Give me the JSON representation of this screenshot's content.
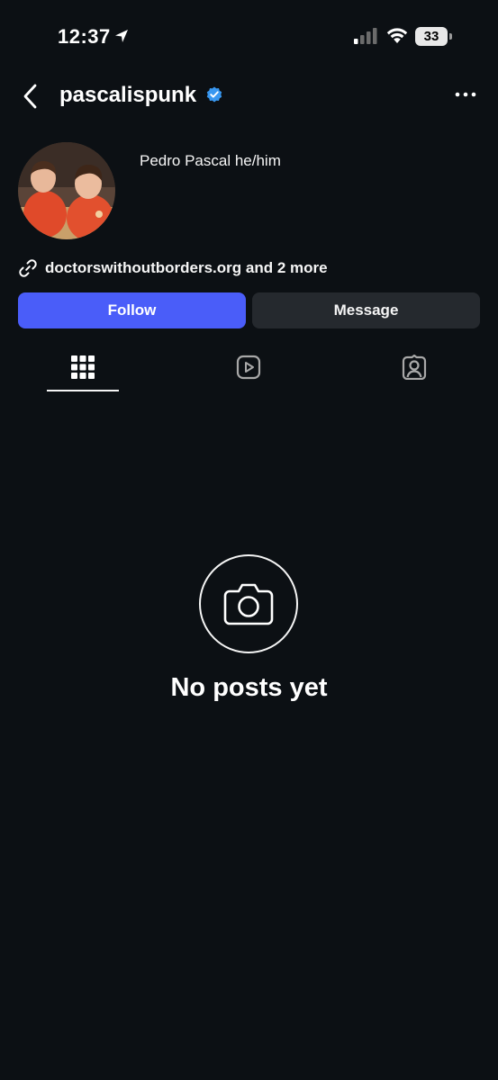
{
  "status_bar": {
    "time": "12:37",
    "battery": "33"
  },
  "header": {
    "username": "pascalispunk"
  },
  "profile": {
    "display_name": "Pedro Pascal he/him",
    "link": "doctorswithoutborders.org and 2 more"
  },
  "actions": {
    "follow": "Follow",
    "message": "Message"
  },
  "tabs": [
    {
      "icon": "grid-icon",
      "active": true
    },
    {
      "icon": "reels-icon",
      "active": false
    },
    {
      "icon": "tagged-icon",
      "active": false
    }
  ],
  "empty_state": {
    "title": "No posts yet"
  },
  "colors": {
    "background": "#0c1014",
    "follow_button": "#4a5df9",
    "message_button": "#25292e",
    "verified_badge": "#3897f0"
  }
}
